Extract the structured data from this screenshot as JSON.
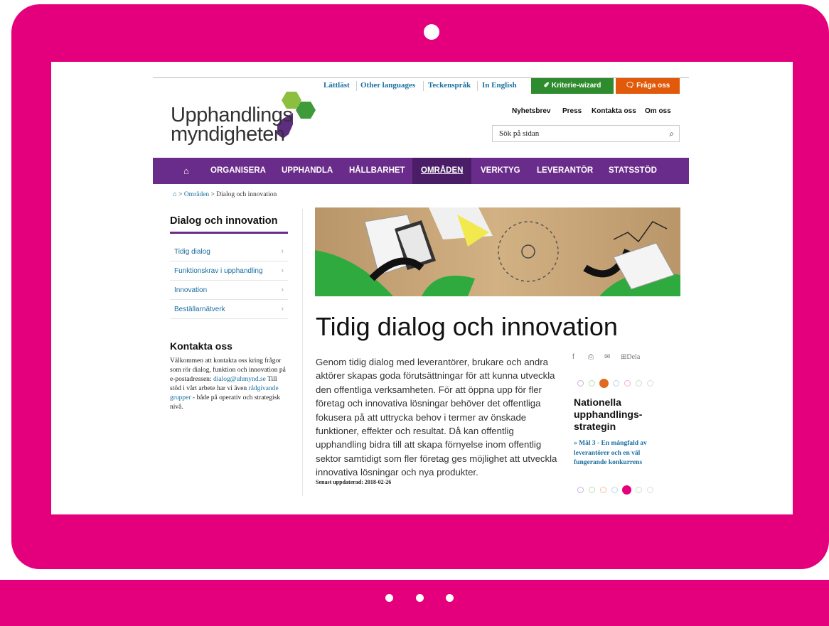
{
  "utility_nav": [
    "Lättläst",
    "Other languages",
    "Teckenspråk",
    "In English"
  ],
  "buttons": {
    "wizard": "Kriterie-wizard",
    "fraga": "Fråga oss"
  },
  "logo": {
    "line1": "Upphandlings",
    "line2": "myndigheten"
  },
  "secondary_nav": [
    "Nyhetsbrev",
    "Press",
    "Kontakta oss",
    "Om oss"
  ],
  "search": {
    "placeholder": "Sök på sidan"
  },
  "main_nav": [
    "ORGANISERA",
    "UPPHANDLA",
    "HÅLLBARHET",
    "OMRÅDEN",
    "VERKTYG",
    "LEVERANTÖR",
    "STATSSTÖD"
  ],
  "active_nav": "OMRÅDEN",
  "breadcrumb": {
    "level1": "Områden",
    "current": "Dialog och innovation"
  },
  "sidebar": {
    "title": "Dialog och innovation",
    "items": [
      "Tidig dialog",
      "Funktionskrav i upphandling",
      "Innovation",
      "Beställarnätverk"
    ]
  },
  "contact": {
    "title": "Kontakta oss",
    "text1": "Välkommen att kontakta oss kring frågor som rör dialog, funktion och innovation på e-postadressen: ",
    "email": "dialog@uhmynd.se",
    "text2": " Till stöd i vårt arbete har vi även ",
    "link": "rådgivande grupper",
    "text3": " - både på operativ och strategisk nivå."
  },
  "article": {
    "title": "Tidig dialog och innovation",
    "body": "Genom tidig dialog med leverantörer, brukare och andra aktörer skapas goda förutsättningar för att kunna utveckla den offentliga verksamheten. För att öppna upp för fler företag och innovativa lösningar behöver det offentliga fokusera på att uttrycka behov i termer av önskade funktioner, effekter och resultat. Då kan offentlig upphandling bidra till att skapa förnyelse inom offentlig sektor samtidigt som fler företag ges möjlighet att utveckla innovativa lösningar och nya produkter.",
    "updated": "Senast uppdaterad: 2018-02-26"
  },
  "share": {
    "dela": "Dela"
  },
  "strategy": {
    "title": "Nationella upphandlings-strategin",
    "link": "» Mål 3 - En mångfald av leverantörer och en väl fungerande konkurrens"
  },
  "icons": [
    "home-icon",
    "search-icon",
    "wand-icon",
    "chat-icon",
    "facebook-icon",
    "print-icon",
    "mail-icon",
    "plus-icon",
    "lightbulb-icon"
  ],
  "colors": {
    "frame": "#e4007d",
    "nav": "#6a2c8a",
    "wizard": "#2e8b2e",
    "fraga": "#e05a0a",
    "link": "#1a6fa0"
  }
}
